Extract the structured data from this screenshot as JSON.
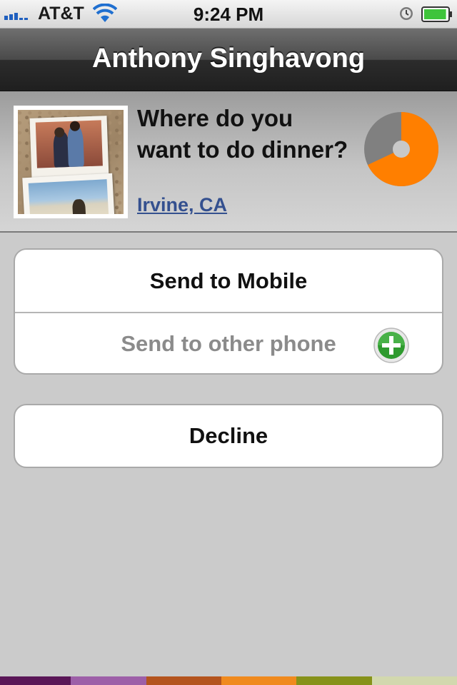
{
  "status_bar": {
    "carrier": "AT&T",
    "time": "9:24 PM",
    "signal_bars": 5,
    "battery_level": 0.9,
    "icons": [
      "signal-icon",
      "wifi-icon",
      "alarm-icon",
      "battery-icon"
    ]
  },
  "nav": {
    "title": "Anthony Singhavong"
  },
  "event": {
    "question": "Where do you want to do dinner?",
    "location": "Irvine, CA",
    "photo": "photo-thumbnail",
    "progress_fraction": 0.68,
    "progress_colors": {
      "filled": "#ff7f00",
      "remaining": "#808080",
      "center": "#c8c8c8"
    }
  },
  "actions": {
    "send_mobile": "Send to Mobile",
    "send_other": "Send to other phone",
    "decline": "Decline",
    "add_icon": "add-icon"
  },
  "colors": {
    "accent_orange": "#ff7f00",
    "link": "#34508f",
    "background": "#cbcbcb",
    "stripe": [
      "#5a1657",
      "#9d5fa8",
      "#b4541e",
      "#f08a1e",
      "#86921a",
      "#d2d8ae"
    ]
  }
}
